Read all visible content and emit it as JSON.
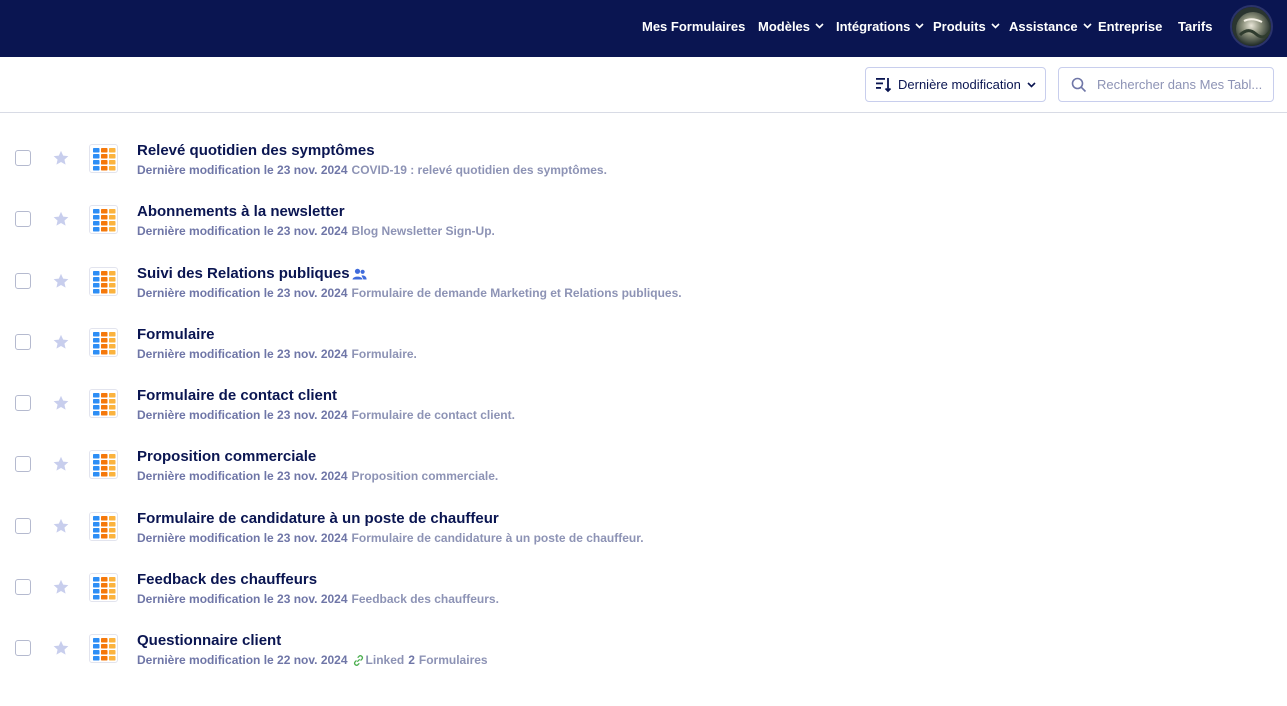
{
  "nav": {
    "items": [
      {
        "label": "Mes Formulaires",
        "dropdown": false
      },
      {
        "label": "Modèles",
        "dropdown": true
      },
      {
        "label": "Intégrations",
        "dropdown": true
      },
      {
        "label": "Produits",
        "dropdown": true
      },
      {
        "label": "Assistance",
        "dropdown": true
      },
      {
        "label": "Entreprise",
        "dropdown": false
      },
      {
        "label": "Tarifs",
        "dropdown": false
      }
    ],
    "avatar_icon": "user-avatar-globe"
  },
  "toolbar": {
    "sort_label": "Dernière modification",
    "sort_icon": "sort-descending-icon",
    "search_placeholder": "Rechercher dans Mes Tabl..."
  },
  "colors": {
    "nav_bg": "#0a1551",
    "title": "#0a1551",
    "meta": "#8d93b5",
    "star": "#c8ceed",
    "link_green": "#4caf50",
    "shared_blue": "#3f6bdb"
  },
  "forms": [
    {
      "title": "Relevé quotidien des symptômes",
      "date": "Dernière modification le 23 nov. 2024",
      "description": "COVID-19 : relevé quotidien des symptômes.",
      "shared": false
    },
    {
      "title": "Abonnements à la newsletter",
      "date": "Dernière modification le 23 nov. 2024",
      "description": "Blog Newsletter Sign-Up.",
      "shared": false
    },
    {
      "title": "Suivi des Relations publiques",
      "date": "Dernière modification le 23 nov. 2024",
      "description": "Formulaire de demande Marketing et Relations publiques.",
      "shared": true
    },
    {
      "title": "Formulaire",
      "date": "Dernière modification le 23 nov. 2024",
      "description": "Formulaire.",
      "shared": false
    },
    {
      "title": "Formulaire de contact client",
      "date": "Dernière modification le 23 nov. 2024",
      "description": "Formulaire de contact client.",
      "shared": false
    },
    {
      "title": "Proposition commerciale",
      "date": "Dernière modification le 23 nov. 2024",
      "description": "Proposition commerciale.",
      "shared": false
    },
    {
      "title": "Formulaire de candidature à un poste de chauffeur",
      "date": "Dernière modification le 23 nov. 2024",
      "description": "Formulaire de candidature à un poste de chauffeur.",
      "shared": false
    },
    {
      "title": "Feedback des chauffeurs",
      "date": "Dernière modification le 23 nov. 2024",
      "description": "Feedback des chauffeurs.",
      "shared": false
    },
    {
      "title": "Questionnaire client",
      "date": "Dernière modification le 22 nov. 2024",
      "description": "",
      "shared": false,
      "linked": {
        "prefix": "Linked",
        "count": "2",
        "suffix": "Formulaires"
      }
    }
  ]
}
